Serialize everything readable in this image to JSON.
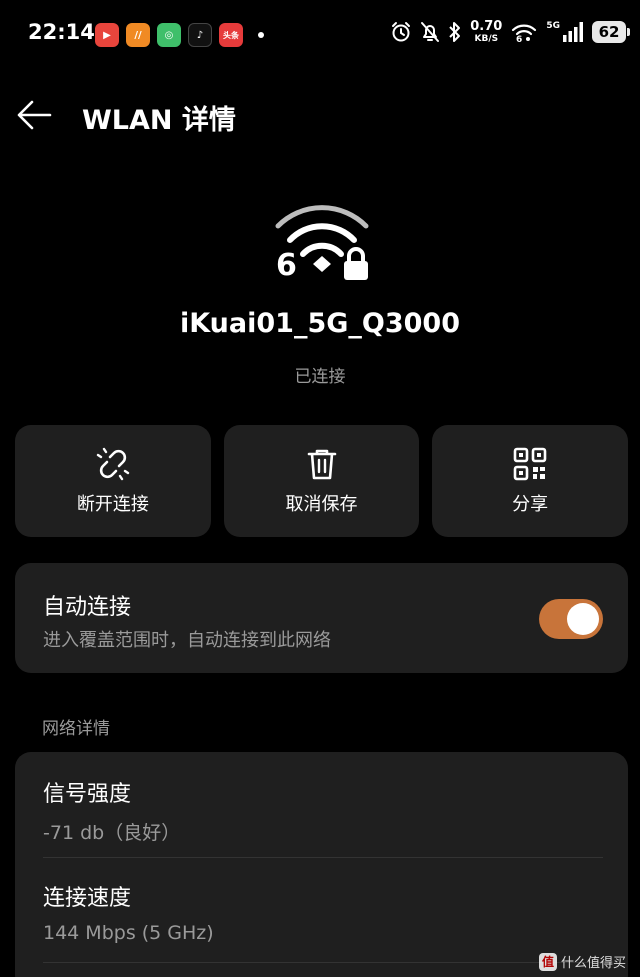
{
  "status_bar": {
    "time": "22:14",
    "net_speed_value": "0.70",
    "net_speed_unit": "KB/S",
    "network_type": "5G",
    "battery": "62",
    "notification_apps": [
      {
        "name": "video-app-icon",
        "color": "#e8453c",
        "glyph": "▶"
      },
      {
        "name": "orange-app-icon",
        "color": "#f08a24",
        "glyph": "//"
      },
      {
        "name": "green-app-icon",
        "color": "#3fbf6a",
        "glyph": "◎"
      },
      {
        "name": "tiktok-app-icon",
        "color": "#111111",
        "glyph": "♪"
      },
      {
        "name": "toutiao-app-icon",
        "color": "#e63b3b",
        "glyph": "头条"
      }
    ]
  },
  "header": {
    "title": "WLAN 详情"
  },
  "network": {
    "wifi_generation": "6",
    "ssid": "iKuai01_5G_Q3000",
    "status": "已连接"
  },
  "actions": [
    {
      "key": "disconnect",
      "label": "断开连接",
      "icon": "unlink-icon"
    },
    {
      "key": "forget",
      "label": "取消保存",
      "icon": "trash-icon"
    },
    {
      "key": "share",
      "label": "分享",
      "icon": "qr-code-icon"
    }
  ],
  "auto_connect": {
    "title": "自动连接",
    "description": "进入覆盖范围时，自动连接到此网络",
    "enabled": true,
    "toggle_color": "#c8743a"
  },
  "details": {
    "section_title": "网络详情",
    "items": [
      {
        "label": "信号强度",
        "value": "-71 db（良好）"
      },
      {
        "label": "连接速度",
        "value": "144 Mbps (5 GHz)"
      }
    ]
  },
  "watermark": {
    "badge": "值",
    "text": "什么值得买"
  }
}
